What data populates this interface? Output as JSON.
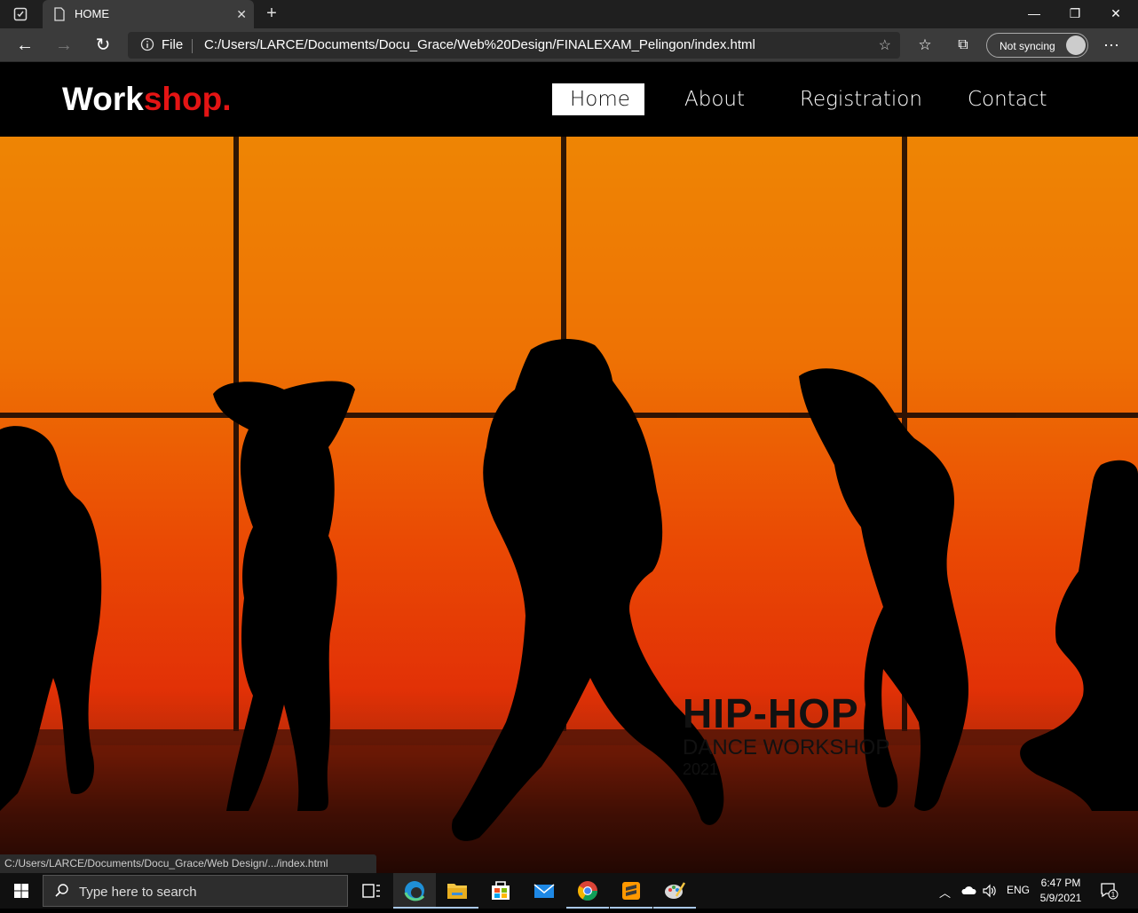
{
  "browser": {
    "tab_title": "HOME",
    "address_scheme_label": "File",
    "url": "C:/Users/LARCE/Documents/Docu_Grace/Web%20Design/FINALEXAM_Pelingon/index.html",
    "sync_label": "Not syncing",
    "status_url": "C:/Users/LARCE/Documents/Docu_Grace/Web Design/.../index.html"
  },
  "site": {
    "logo_part1": "Work",
    "logo_part2": "shop.",
    "nav": [
      {
        "label": "Home",
        "active": true
      },
      {
        "label": "About",
        "active": false
      },
      {
        "label": "Registration",
        "active": false
      },
      {
        "label": "Contact",
        "active": false
      }
    ],
    "hero": {
      "title": "HIP-HOP",
      "subtitle": "DANCE WORKSHOP",
      "year": "2021"
    }
  },
  "taskbar": {
    "search_placeholder": "Type here to search",
    "language": "ENG",
    "time": "6:47 PM",
    "date": "5/9/2021",
    "notification_count": "1",
    "pinned_apps": [
      "task-view",
      "edge",
      "file-explorer",
      "store",
      "mail",
      "chrome",
      "sublime-text",
      "paint"
    ]
  },
  "colors": {
    "accent_red": "#e41414",
    "hero_orange": "#ee8504",
    "hero_red": "#e23106"
  }
}
